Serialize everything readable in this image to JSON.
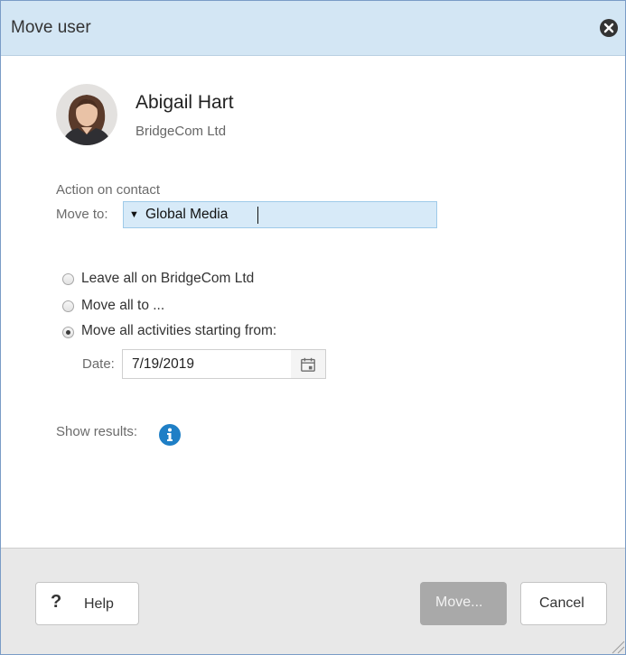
{
  "dialog": {
    "title": "Move user",
    "close_icon": "close-circle-icon"
  },
  "user": {
    "name": "Abigail Hart",
    "company": "BridgeCom Ltd",
    "avatar_icon": "user-photo"
  },
  "action": {
    "section_label": "Action on contact",
    "move_to_label": "Move to:",
    "move_to_value": "Global Media",
    "dropdown_icon": "triangle-down-icon"
  },
  "options": [
    {
      "label": "Leave all on BridgeCom Ltd",
      "selected": false
    },
    {
      "label": "Move all to ...",
      "selected": false
    },
    {
      "label": "Move all activities starting from:",
      "selected": true
    }
  ],
  "date": {
    "label": "Date:",
    "value": "7/19/2019",
    "picker_icon": "calendar-icon"
  },
  "results": {
    "label": "Show results:",
    "icon": "info-icon",
    "accent": "#1f7fc6"
  },
  "footer": {
    "help_label": "Help",
    "help_icon": "question-mark-icon",
    "move_label": "Move...",
    "cancel_label": "Cancel"
  },
  "colors": {
    "titlebar": "#d3e6f4",
    "field_highlight": "#d7eaf8",
    "footer_bg": "#e8e8e8",
    "disabled_button": "#a9a9a9"
  }
}
